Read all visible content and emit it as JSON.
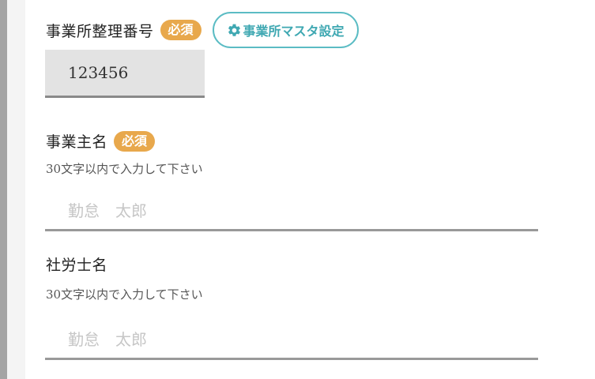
{
  "office_number": {
    "label": "事業所整理番号",
    "required_badge": "必須",
    "master_button_label": "事業所マスタ設定",
    "value": "123456"
  },
  "owner_name": {
    "label": "事業主名",
    "required_badge": "必須",
    "hint": "30文字以内で入力して下さい",
    "placeholder": "勤怠　太郎"
  },
  "labor_consultant_name": {
    "label": "社労士名",
    "hint": "30文字以内で入力して下さい",
    "placeholder": "勤怠　太郎"
  },
  "colors": {
    "badge": "#e8a84c",
    "master_button": "#5bbcc4",
    "input_fill": "#e3e3e3",
    "underline": "#999999"
  },
  "icons": {
    "master_button": "gear-icon"
  }
}
